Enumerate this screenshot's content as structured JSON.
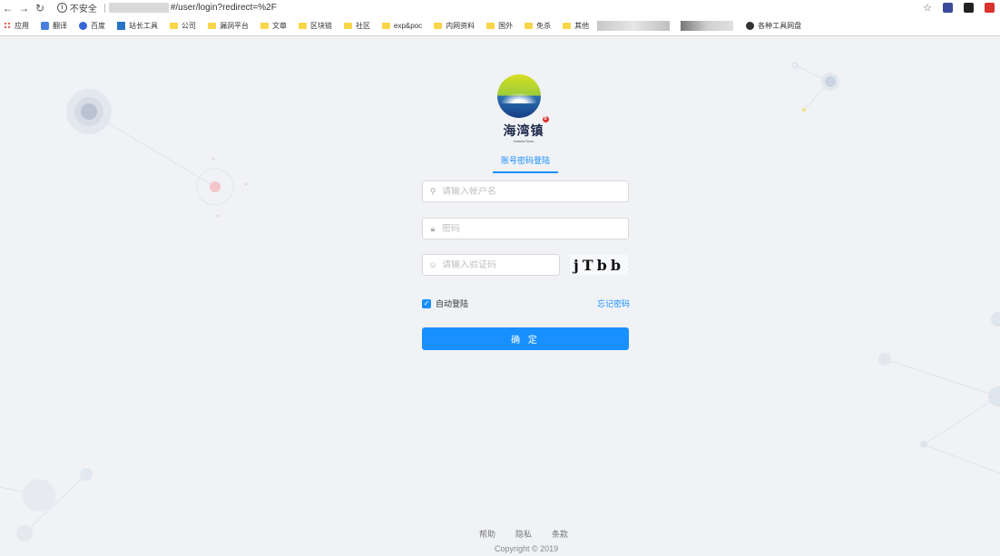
{
  "browser": {
    "security_label": "不安全",
    "url_path": "#/user/login?redirect=%2F",
    "bookmarks": [
      "应用",
      "翻译",
      "百度",
      "站长工具",
      "公司",
      "漏洞平台",
      "文章",
      "区块链",
      "社区",
      "exp&poc",
      "内网资料",
      "国外",
      "免杀",
      "其他",
      "各种工具网盘"
    ]
  },
  "brand": {
    "name": "海湾镇",
    "subtitle": "HaiwanTown",
    "badge": "0"
  },
  "login": {
    "tab_label": "账号密码登陆",
    "username_placeholder": "请输入帐户名",
    "password_placeholder": "密码",
    "captcha_placeholder": "请输入验证码",
    "captcha_text": "jTbb",
    "remember_label": "自动登陆",
    "remember_checked": true,
    "forgot_label": "忘记密码",
    "submit_label": "确 定"
  },
  "footer": {
    "links": [
      "帮助",
      "隐私",
      "条款"
    ],
    "copyright": "Copyright © 2019"
  },
  "colors": {
    "accent": "#1890ff",
    "background": "#f0f2f5"
  }
}
